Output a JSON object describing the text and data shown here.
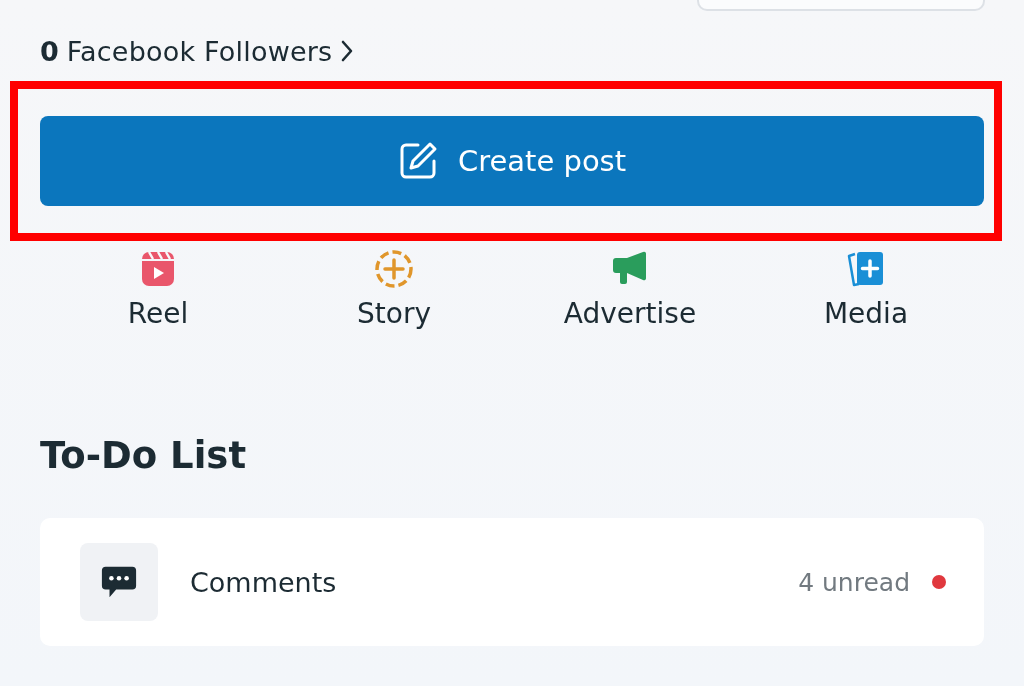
{
  "followers": {
    "count": "0",
    "label": "Facebook Followers"
  },
  "create_post": {
    "label": "Create post",
    "highlighted": true
  },
  "actions": [
    {
      "label": "Reel",
      "kind": "reel"
    },
    {
      "label": "Story",
      "kind": "story"
    },
    {
      "label": "Advertise",
      "kind": "advertise"
    },
    {
      "label": "Media",
      "kind": "media"
    }
  ],
  "todo": {
    "title": "To-Do List",
    "items": [
      {
        "label": "Comments",
        "kind": "comments",
        "status": "4 unread",
        "unread": true
      }
    ]
  }
}
